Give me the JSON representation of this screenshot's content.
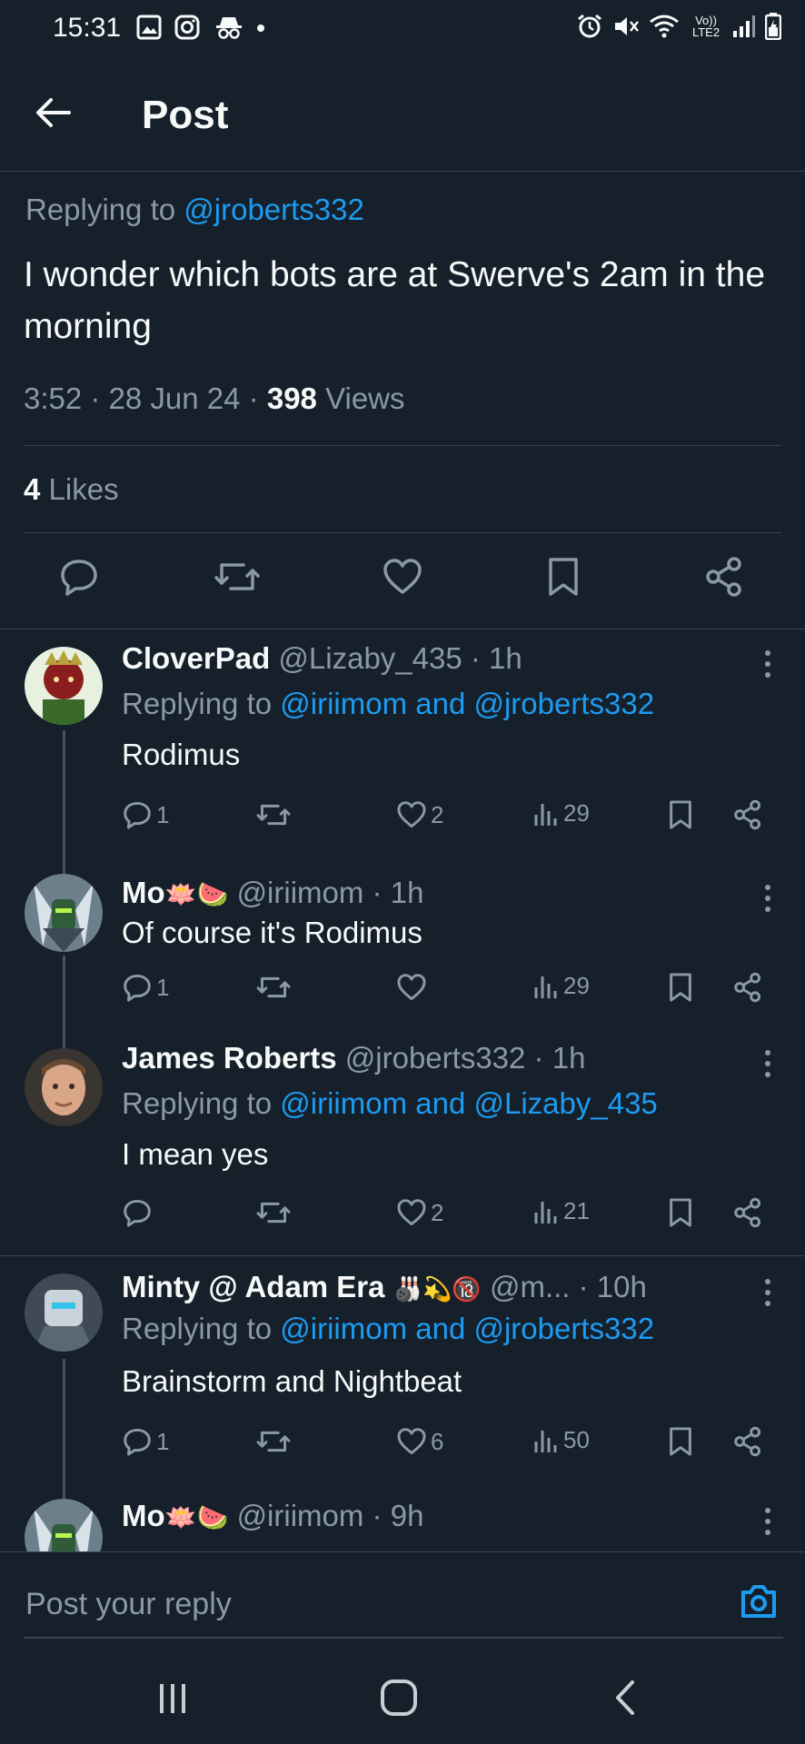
{
  "status_bar": {
    "time": "15:31",
    "network_label": "Vo)) LTE2"
  },
  "header": {
    "title": "Post"
  },
  "main_post": {
    "replying_prefix": "Replying to ",
    "replying_to": "@jroberts332",
    "text": "I wonder which bots are at Swerve's 2am in the morning",
    "time": "3:52 · 28 Jun 24 · ",
    "views_count": "398",
    "views_label": " Views",
    "likes_count": "4",
    "likes_label": " Likes"
  },
  "replies": [
    {
      "name": "CloverPad",
      "handle": "@Lizaby_435",
      "time": " · 1h",
      "replying_prefix": "Replying to ",
      "replying_to": "@iriimom and @jroberts332",
      "text": "Rodimus",
      "replies": "1",
      "likes": "2",
      "views": "29"
    },
    {
      "name": "Mo",
      "name_emoji": "🪷🍉",
      "handle": "@iriimom",
      "time": " · 1h",
      "text": "Of course it's Rodimus",
      "replies": "1",
      "likes": "",
      "views": "29"
    },
    {
      "name": "James Roberts",
      "handle": "@jroberts332",
      "time": " · 1h",
      "replying_prefix": "Replying to ",
      "replying_to": "@iriimom and @Lizaby_435",
      "text": "I mean yes",
      "replies": "",
      "likes": "2",
      "views": "21"
    },
    {
      "name": "Minty @ Adam Era",
      "name_emoji": "🎳💫🔞",
      "handle": "@m...",
      "time": " · 10h",
      "replying_prefix": "Replying to ",
      "replying_to": "@iriimom and @jroberts332",
      "text": "Brainstorm and Nightbeat",
      "replies": "1",
      "likes": "6",
      "views": "50"
    },
    {
      "name": "Mo",
      "name_emoji": "🪷🍉",
      "handle": "@iriimom",
      "time": " · 9h"
    }
  ],
  "composer": {
    "placeholder": "Post your reply"
  },
  "colors": {
    "background": "#15202b",
    "accent": "#1d9bf0",
    "muted": "#8b98a5",
    "divider": "#38444d"
  }
}
